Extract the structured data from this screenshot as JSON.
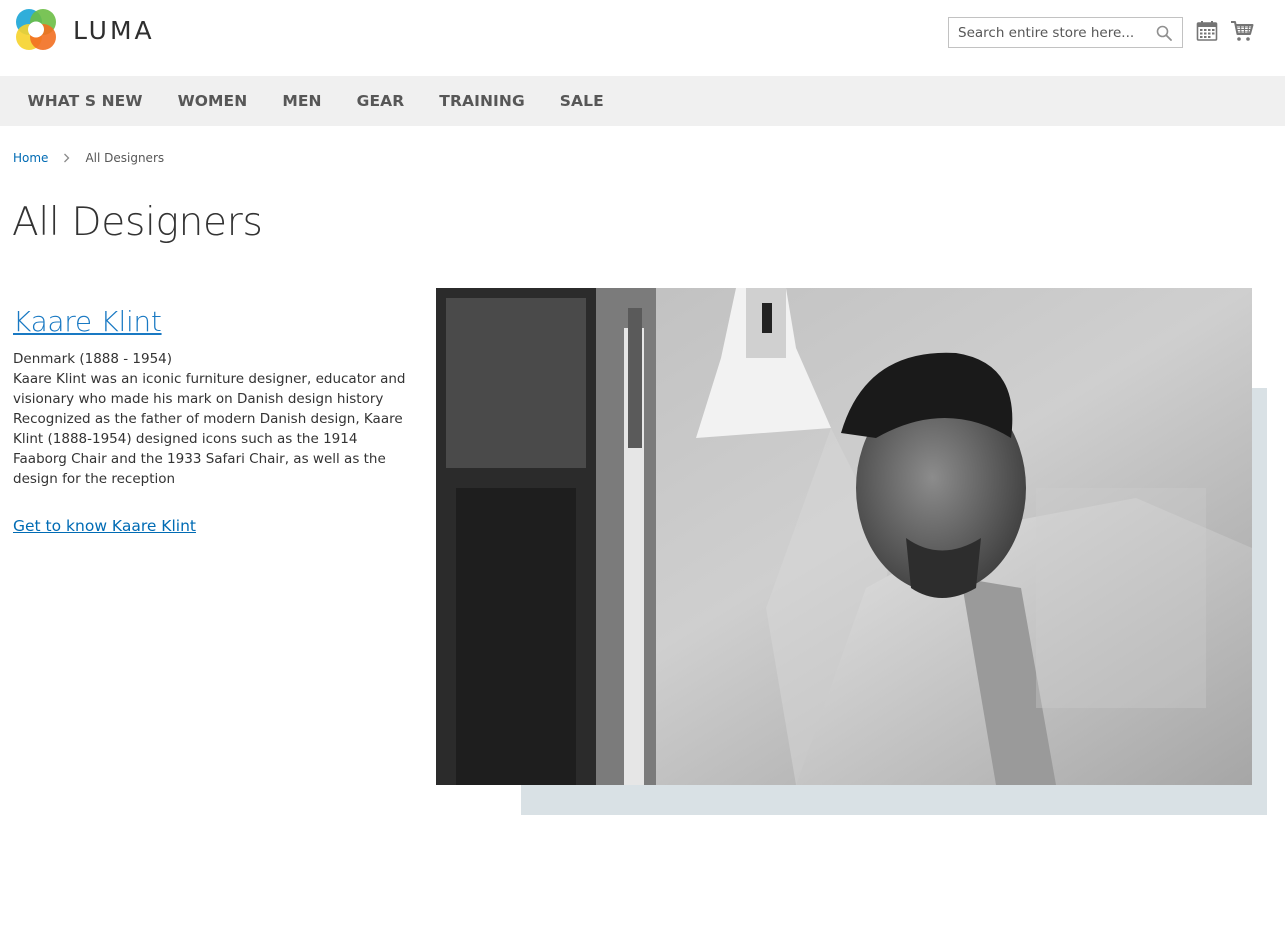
{
  "header": {
    "logo_text": "LUMA",
    "search_placeholder": "Search entire store here...",
    "icons": {
      "search": "search-icon",
      "compare": "calendar-icon",
      "cart": "cart-icon"
    }
  },
  "nav": {
    "items": [
      "WHAT S NEW",
      "WOMEN",
      "MEN",
      "GEAR",
      "TRAINING",
      "SALE"
    ]
  },
  "breadcrumb": {
    "home": "Home",
    "current": "All Designers"
  },
  "page": {
    "title": "All Designers"
  },
  "designer": {
    "name": "Kaare Klint",
    "meta": "Denmark (1888 - 1954)",
    "description": "Kaare Klint was an iconic furniture designer, educator and visionary who made his mark on Danish design history Recognized as the father of modern Danish design, Kaare Klint (1888-1954) designed icons such as the 1914 Faaborg Chair and the 1933 Safari Chair, as well as the design for the reception",
    "link": "Get to know Kaare Klint"
  },
  "colors": {
    "link": "#006bb4",
    "designer_name": "#1979c3",
    "nav_bg": "#f0f0f0",
    "photo_backdrop": "#d9e1e5"
  }
}
